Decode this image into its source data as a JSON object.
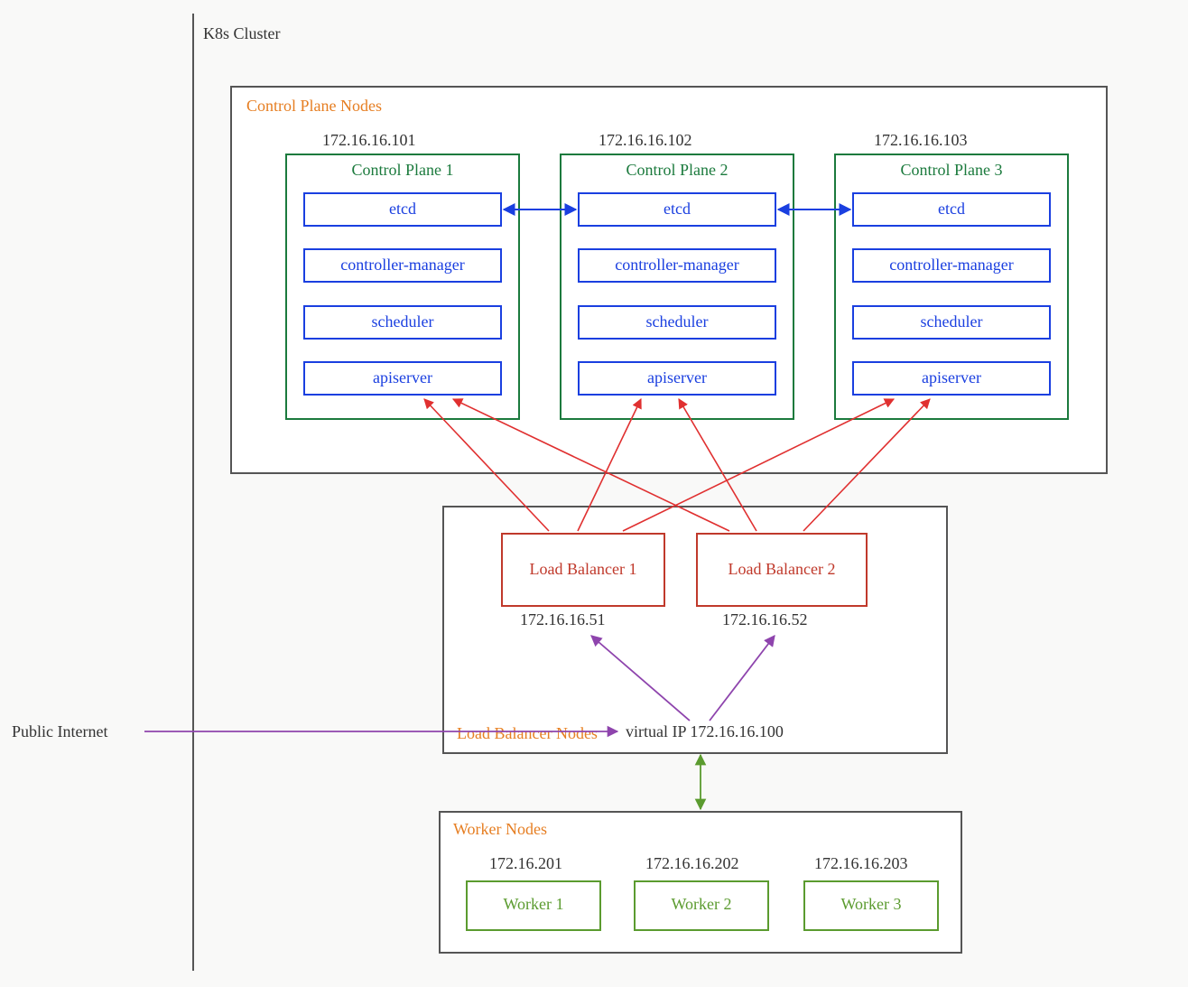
{
  "cluster": {
    "title": "K8s Cluster"
  },
  "public_internet_label": "Public Internet",
  "control_plane_group": {
    "title": "Control Plane Nodes",
    "nodes": [
      {
        "ip": "172.16.16.101",
        "name": "Control Plane 1",
        "components": [
          "etcd",
          "controller-manager",
          "scheduler",
          "apiserver"
        ]
      },
      {
        "ip": "172.16.16.102",
        "name": "Control Plane 2",
        "components": [
          "etcd",
          "controller-manager",
          "scheduler",
          "apiserver"
        ]
      },
      {
        "ip": "172.16.16.103",
        "name": "Control Plane 3",
        "components": [
          "etcd",
          "controller-manager",
          "scheduler",
          "apiserver"
        ]
      }
    ]
  },
  "lb_group": {
    "title": "Load Balancer Nodes",
    "virtual_ip_label": "virtual IP 172.16.16.100",
    "nodes": [
      {
        "name": "Load Balancer 1",
        "ip": "172.16.16.51"
      },
      {
        "name": "Load Balancer 2",
        "ip": "172.16.16.52"
      }
    ]
  },
  "worker_group": {
    "title": "Worker Nodes",
    "nodes": [
      {
        "name": "Worker 1",
        "ip": "172.16.201"
      },
      {
        "name": "Worker 2",
        "ip": "172.16.16.202"
      },
      {
        "name": "Worker 3",
        "ip": "172.16.16.203"
      }
    ]
  },
  "colors": {
    "blue": "#1a3fe0",
    "red": "#e03030",
    "purple": "#8e44ad",
    "green": "#5b9b2f",
    "dark": "#555"
  }
}
